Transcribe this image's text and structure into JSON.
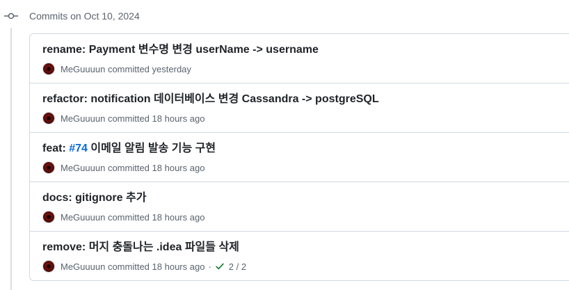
{
  "group": {
    "title": "Commits on Oct 10, 2024"
  },
  "commits": [
    {
      "title_prefix": "rename: Payment ",
      "title_rest": "변수명 변경 userName -> username",
      "author": "MeGuuuun",
      "action": "committed",
      "time": "yesterday"
    },
    {
      "title_prefix": "refactor: notification ",
      "title_rest": "데이터베이스 변경 Cassandra -> postgreSQL",
      "author": "MeGuuuun",
      "action": "committed",
      "time": "18 hours ago"
    },
    {
      "title_prefix": "feat: ",
      "issue": "#74",
      "title_rest": " 이메일 알림 발송 기능 구현",
      "author": "MeGuuuun",
      "action": "committed",
      "time": "18 hours ago"
    },
    {
      "title_prefix": "docs: gitignore ",
      "title_rest": "추가",
      "author": "MeGuuuun",
      "action": "committed",
      "time": "18 hours ago"
    },
    {
      "title_prefix": "remove: ",
      "title_rest": "머지 충돌나는 .idea 파일들 삭제",
      "author": "MeGuuuun",
      "action": "committed",
      "time": "18 hours ago",
      "separator": "·",
      "checks": "2 / 2"
    }
  ],
  "icons": {
    "group": "git-commit-icon",
    "avatar": "user-avatar",
    "status": "check-icon"
  },
  "colors": {
    "link": "#0969da",
    "success": "#1a7f37",
    "muted": "#59636e",
    "border": "#d1d9e0"
  }
}
